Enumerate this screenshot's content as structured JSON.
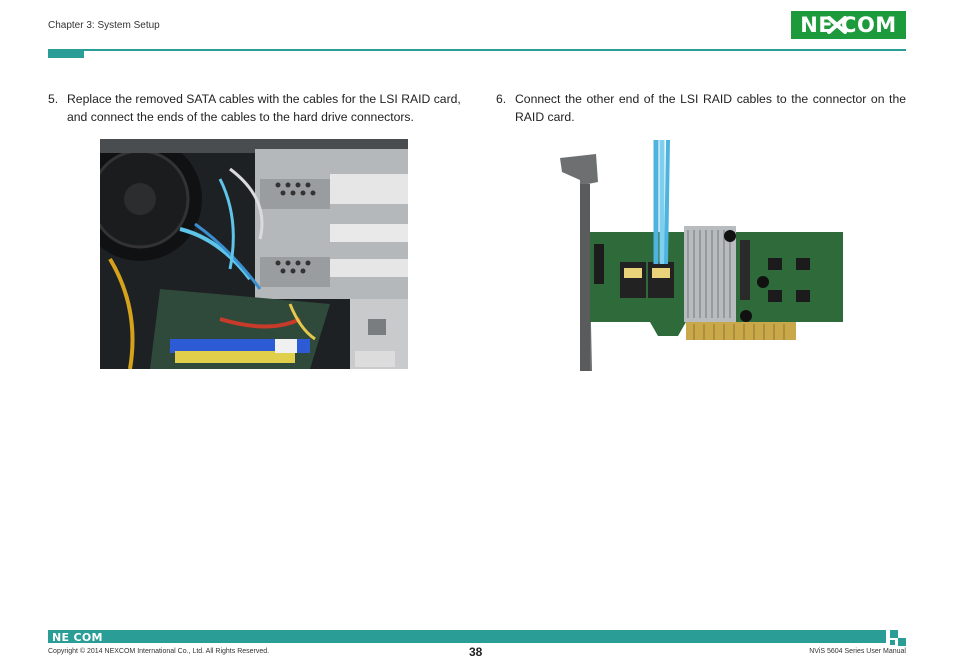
{
  "header": {
    "chapter": "Chapter 3: System Setup",
    "logo_text": "NE COM"
  },
  "steps": [
    {
      "num": "5.",
      "text": "Replace the removed SATA cables with the cables for the LSI RAID card, and connect the ends of the cables to the hard drive connectors."
    },
    {
      "num": "6.",
      "text": "Connect the other end of the LSI RAID cables to the connector on the RAID card."
    }
  ],
  "footer": {
    "logo_text": "NE COM",
    "copyright": "Copyright © 2014 NEXCOM International Co., Ltd. All Rights Reserved.",
    "page_number": "38",
    "manual": "NViS 5604 Series User Manual"
  },
  "colors": {
    "accent": "#2a9d96",
    "logo_green": "#1d9a3c"
  }
}
